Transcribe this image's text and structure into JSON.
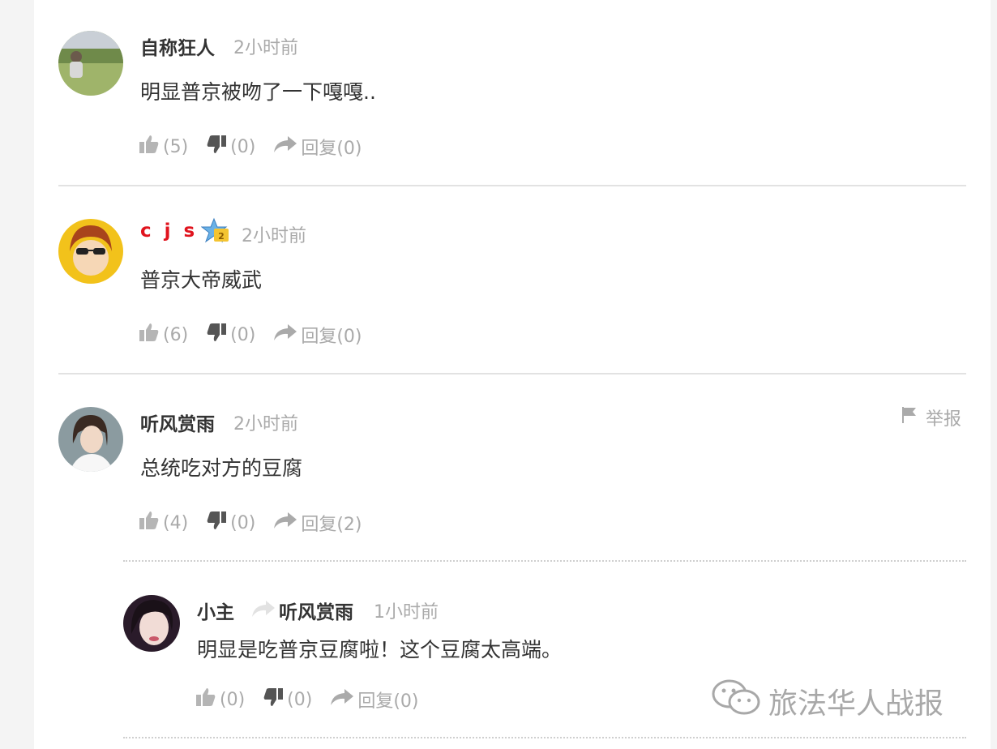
{
  "comments": [
    {
      "user": "自称狂人",
      "time": "2小时前",
      "text": "明显普京被吻了一下嘎嘎..",
      "like": "(5)",
      "dislike": "(0)",
      "reply": "回复(0)"
    },
    {
      "user": "c j s",
      "user_color": "#e0141e",
      "time": "2小时前",
      "text": "普京大帝威武",
      "like": "(6)",
      "dislike": "(0)",
      "reply": "回复(0)"
    },
    {
      "user": "听风赏雨",
      "time": "2小时前",
      "text": "总统吃对方的豆腐",
      "like": "(4)",
      "dislike": "(0)",
      "reply": "回复(2)",
      "report": "举报"
    }
  ],
  "reply": {
    "user": "小主",
    "to_user": "听风赏雨",
    "time": "1小时前",
    "text": "明显是吃普京豆腐啦！这个豆腐太高端。",
    "like": "(0)",
    "dislike": "(0)",
    "reply": "回复(0)"
  },
  "watermark": "旅法华人战报",
  "icons": [
    "thumb-up-icon",
    "thumb-down-icon",
    "reply-arrow-icon",
    "flag-icon",
    "vip-badge-icon",
    "wechat-icon"
  ]
}
